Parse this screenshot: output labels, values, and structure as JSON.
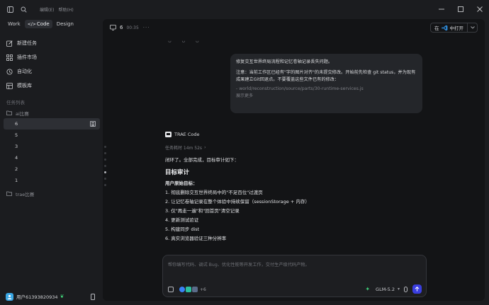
{
  "titlebar": {
    "menu_edit": "编辑(E)",
    "menu_help": "帮助(H)"
  },
  "sidebar": {
    "mode_tabs": [
      "Work",
      "Code",
      "Design"
    ],
    "active_mode": "Code",
    "nav": [
      {
        "icon": "pencil-icon",
        "label": "新建任务"
      },
      {
        "icon": "grid-icon",
        "label": "插件市场"
      },
      {
        "icon": "automation-icon",
        "label": "自动化"
      },
      {
        "icon": "template-icon",
        "label": "模板库"
      }
    ],
    "task_list_title": "任务列表",
    "folders": [
      {
        "name": "ai比赛",
        "tasks": [
          "6",
          "5",
          "3",
          "4",
          "2",
          "1"
        ]
      },
      {
        "name": "trae比赛",
        "tasks": []
      }
    ],
    "active_task": "6",
    "user_name": "用户61393820934"
  },
  "session": {
    "number": "6",
    "time": "00:35",
    "dots": "···",
    "open_in_label": "在",
    "open_in_suffix": "中打开"
  },
  "ghost_glyphs": "ᴗ ᴗ ᴗ",
  "user_message": {
    "line1": "修复交互世界终局流程和记忆卷轴记录丢失问题。",
    "line2": "注意：当前工作区已经有\"字的图片对齐\"的未提交修改。开始前先检查 git status，并为现有成果建立Git回退点。不要覆盖这些文件已有的修改：",
    "path": "- world/reconstruction/source/parts/30-runtime-services.js",
    "more": "展示更多"
  },
  "reply": {
    "agent_name": "TRAE Code",
    "elapsed": "任务耗时 14m 52s",
    "lead": "闭环了。全部完成，目标审计如下：",
    "heading": "目标审计",
    "sub": "用户原始目标：",
    "items": [
      "1. 彻底删除交互世界终局中的\"不足百位\"过渡页",
      "2. 让记忆卷轴记录在整个体验中持续保留（sessionStorage + 内存）",
      "3. 仅\"再走一遍\"和\"回首页\"清空记录",
      "4. 更新测试验证",
      "5. 构建同步 dist",
      "6. 真实浏览器验证三种分辨率"
    ]
  },
  "composer": {
    "placeholder": "帮你编写代码、调试 Bug、优化性能等开发工作，交付生产级代码产物。",
    "agent_count": "+6",
    "model": "GLM-5.2"
  },
  "colors": {
    "accent": "#3a3ee0",
    "success": "#3fd07a",
    "avatar": "#3aa7e4"
  }
}
